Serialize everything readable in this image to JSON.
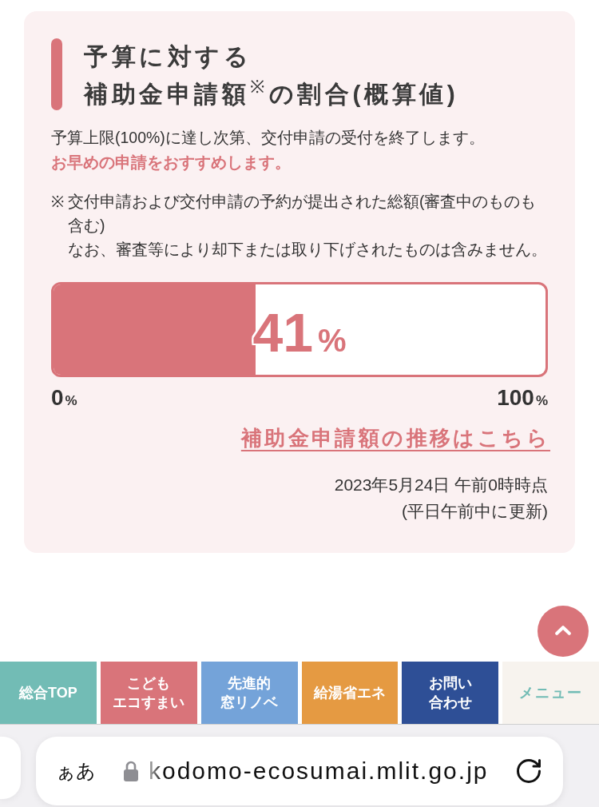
{
  "section": {
    "title_lines": [
      "予算に対する",
      "補助金申請額$^{※}$の割合(概算値)"
    ],
    "notice": "予算上限(100%)に達し次第、交付申請の受付を終了します。",
    "emphasis": "お早めの申請をおすすめします。",
    "footnote": {
      "marker": "※",
      "paragraphs": [
        "交付申請および交付申請の予約が提出された総額(審査中のものも含む)",
        "なお、審査等により却下または取り下げされたものは含みません。"
      ]
    },
    "meter": {
      "level": 0.41,
      "reading": {
        "number": "41",
        "unit": "%"
      },
      "min_label": {
        "number": "0",
        "unit": "%"
      },
      "max_label": {
        "number": "100",
        "unit": "%"
      }
    },
    "history_link": "補助金申請額の推移はこちら",
    "updated": [
      "2023年5月24日 午前0時時点",
      "(平日午前中に更新)"
    ]
  },
  "bottom_nav": [
    {
      "label_lines": [
        "総合TOP"
      ],
      "kind": "link",
      "color": "#72bcb5"
    },
    {
      "label_lines": [
        "こども",
        "エコすまい"
      ],
      "kind": "link",
      "color": "#d9747a"
    },
    {
      "label_lines": [
        "先進的",
        "窓リノベ"
      ],
      "kind": "link",
      "color": "#74a3d9"
    },
    {
      "label_lines": [
        "給湯省エネ"
      ],
      "kind": "link",
      "color": "#e59a42"
    },
    {
      "label_lines": [
        "お問い",
        "合わせ"
      ],
      "kind": "link",
      "color": "#2e4f96"
    },
    {
      "label_lines": [
        "メニュー"
      ],
      "kind": "menu",
      "color": "#f7f3ee"
    }
  ],
  "browser_bar": {
    "text_size": "ぁあ",
    "url": "kodomo-ecosumai.mlit.go.jp"
  }
}
